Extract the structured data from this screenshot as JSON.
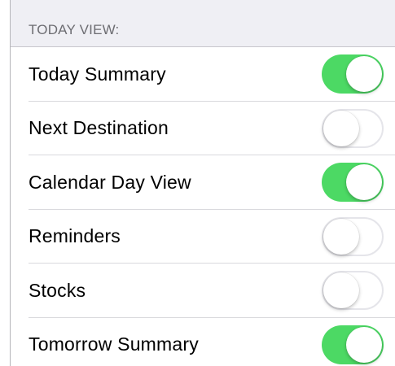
{
  "section": {
    "header": "TODAY VIEW:"
  },
  "rows": [
    {
      "label": "Today Summary",
      "enabled": true
    },
    {
      "label": "Next Destination",
      "enabled": false
    },
    {
      "label": "Calendar Day View",
      "enabled": true
    },
    {
      "label": "Reminders",
      "enabled": false
    },
    {
      "label": "Stocks",
      "enabled": false
    },
    {
      "label": "Tomorrow Summary",
      "enabled": true
    }
  ],
  "colors": {
    "toggle_on": "#4cd964",
    "toggle_off_border": "#e5e5ea",
    "header_background": "#efeff4",
    "header_text": "#6d6d72"
  }
}
